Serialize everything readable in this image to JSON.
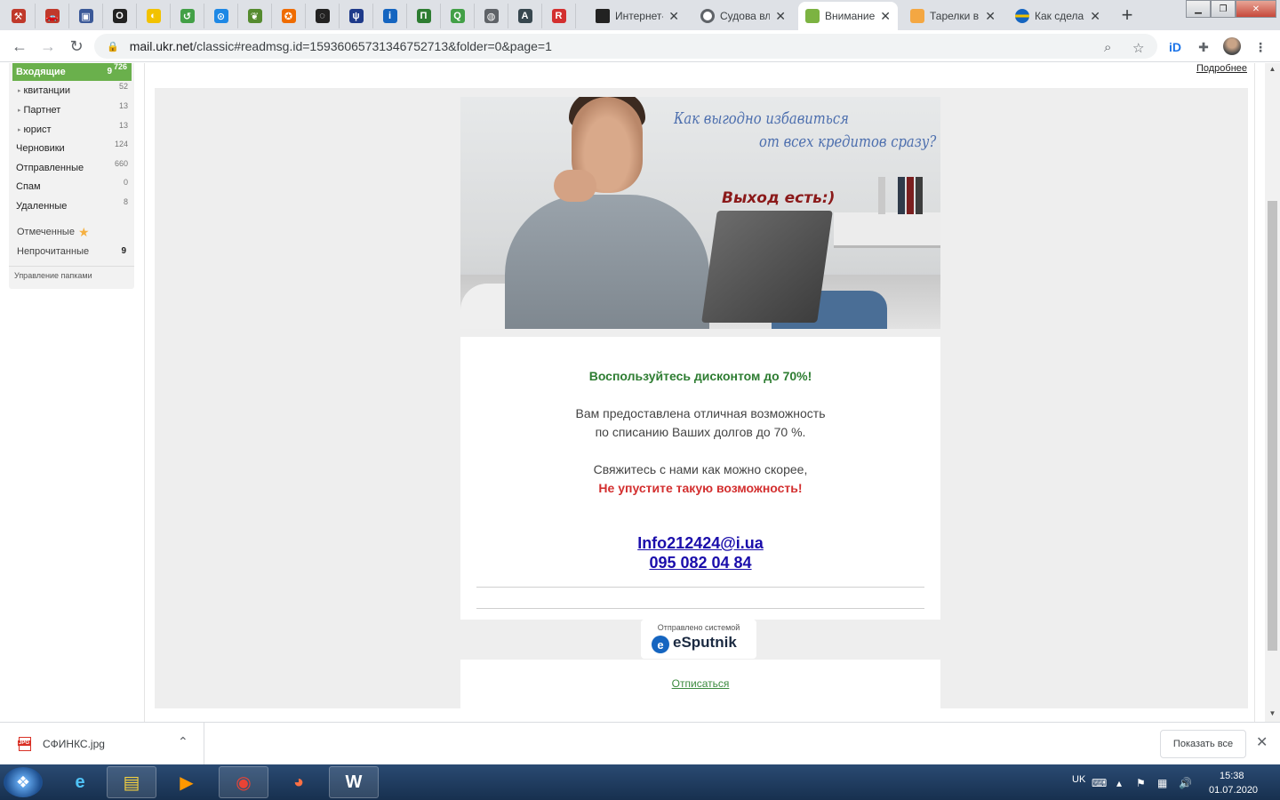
{
  "browser": {
    "tabs": [
      {
        "title": "Интернет-",
        "color": "#222222"
      },
      {
        "title": "Судова вл",
        "color": "#5f6368"
      },
      {
        "title": "Внимание",
        "color": "#7cb342",
        "active": true
      },
      {
        "title": "Тарелки в",
        "color": "#f4a742"
      },
      {
        "title": "Как сдела",
        "color": "#f2c200"
      }
    ],
    "pinned": [
      {
        "icon": "hammer-icon",
        "glyph": "⚒",
        "color": "#c0392b"
      },
      {
        "icon": "car-icon",
        "glyph": "🚗",
        "color": "#c0392b"
      },
      {
        "icon": "picture-icon",
        "glyph": "▣",
        "color": "#3b5998"
      },
      {
        "icon": "opera-icon",
        "glyph": "O",
        "color": "#222222"
      },
      {
        "icon": "ukraine-flag-icon",
        "glyph": "◐",
        "color": "#f2c200"
      },
      {
        "icon": "green-swirl-icon",
        "glyph": "↺",
        "color": "#43a047"
      },
      {
        "icon": "map-pin-icon",
        "glyph": "⊙",
        "color": "#1e88e5"
      },
      {
        "icon": "leaf-icon",
        "glyph": "❦",
        "color": "#558b2f"
      },
      {
        "icon": "orange-badge-icon",
        "glyph": "✪",
        "color": "#ef6c00"
      },
      {
        "icon": "ring-icon",
        "glyph": "◌",
        "color": "#222222"
      },
      {
        "icon": "trident-icon",
        "glyph": "ψ",
        "color": "#1e3a8a"
      },
      {
        "icon": "info-icon",
        "glyph": "i",
        "color": "#1565c0"
      },
      {
        "icon": "privat-icon",
        "glyph": "П",
        "color": "#2e7d32"
      },
      {
        "icon": "q-icon",
        "glyph": "Q",
        "color": "#43a047"
      },
      {
        "icon": "globe-icon",
        "glyph": "◍",
        "color": "#5f6368"
      },
      {
        "icon": "a-icon",
        "glyph": "A",
        "color": "#37474f"
      },
      {
        "icon": "rst-icon",
        "glyph": "R",
        "color": "#d32f2f"
      }
    ],
    "newtab_glyph": "+",
    "url_host": "mail.ukr.net",
    "url_path": "/classic#readmsg.id=15936065731346752713&folder=0&page=1"
  },
  "sidebar": {
    "inbox": {
      "label": "Входящие",
      "count": "9",
      "total": "726"
    },
    "folders": [
      {
        "label": "квитанции",
        "count": "52",
        "sub": true
      },
      {
        "label": "Партнет",
        "count": "13",
        "sub": true
      },
      {
        "label": "юрист",
        "count": "13",
        "sub": true
      },
      {
        "label": "Черновики",
        "count": "124"
      },
      {
        "label": "Отправленные",
        "count": "660"
      },
      {
        "label": "Спам",
        "count": "0"
      },
      {
        "label": "Удаленные",
        "count": "8"
      }
    ],
    "flagged": "Отмеченные",
    "unread": {
      "label": "Непрочитанные",
      "count": "9"
    },
    "manage": "Управление папками"
  },
  "message": {
    "more_link": "Подробнее",
    "hero": {
      "line1": "Как выгодно избавиться",
      "line2": "от всех кредитов сразу?",
      "exit": "Выход есть:)"
    },
    "discount": "Воспользуйтесь дисконтом до 70%!",
    "line1": "Вам предоставлена отличная возможность",
    "line2": "по списанию Ваших долгов до 70 %.",
    "line3": "Свяжитесь с нами как можно скорее,",
    "cta": "Не упустите такую возможность!",
    "email": "Info212424@i.ua",
    "phone": "095 082 04 84",
    "sent_by": "Отправлено системой",
    "esputnik": "eSputnik",
    "unsubscribe": "Отписаться"
  },
  "downloads": {
    "file": "СФИНКС.jpg",
    "show_all": "Показать все"
  },
  "taskbar": {
    "lang": "UK",
    "time": "15:38",
    "date": "01.07.2020"
  }
}
